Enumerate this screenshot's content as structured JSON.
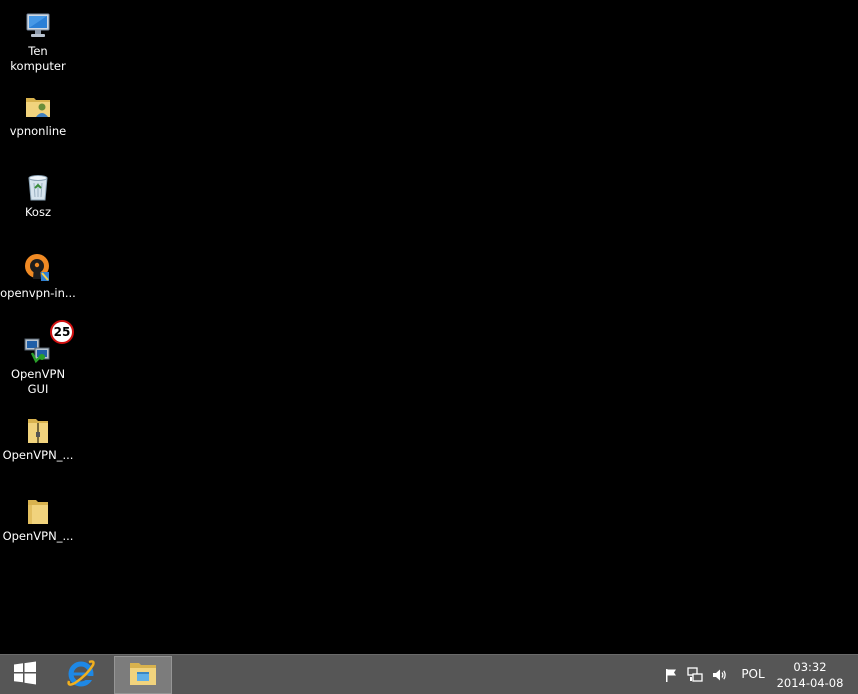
{
  "desktop": {
    "icons": [
      {
        "label": "Ten komputer",
        "icon": "computer-icon"
      },
      {
        "label": "vpnonline",
        "icon": "user-folder-icon"
      },
      {
        "label": "Kosz",
        "icon": "recycle-bin-icon"
      },
      {
        "label": "openvpn-in...",
        "icon": "openvpn-installer-icon"
      },
      {
        "label": "OpenVPN GUI",
        "icon": "openvpn-gui-icon",
        "badge": "25"
      },
      {
        "label": "OpenVPN_...",
        "icon": "zip-folder-icon"
      },
      {
        "label": "OpenVPN_...",
        "icon": "folder-icon"
      }
    ]
  },
  "taskbar": {
    "start_icon": "windows-logo-icon",
    "pinned": [
      {
        "name": "Internet Explorer",
        "icon": "internet-explorer-icon"
      },
      {
        "name": "File Explorer",
        "icon": "file-explorer-icon",
        "active": true
      }
    ],
    "tray": {
      "icons": [
        "action-center-flag-icon",
        "network-icon",
        "volume-icon"
      ],
      "language": "POL",
      "time": "03:32",
      "date": "2014-04-08"
    }
  },
  "colors": {
    "desktop_bg": "#000000",
    "taskbar_bg": "#565656",
    "folder_yellow": "#e8c766",
    "ie_blue": "#1e88e5",
    "openvpn_orange": "#f08a24"
  }
}
